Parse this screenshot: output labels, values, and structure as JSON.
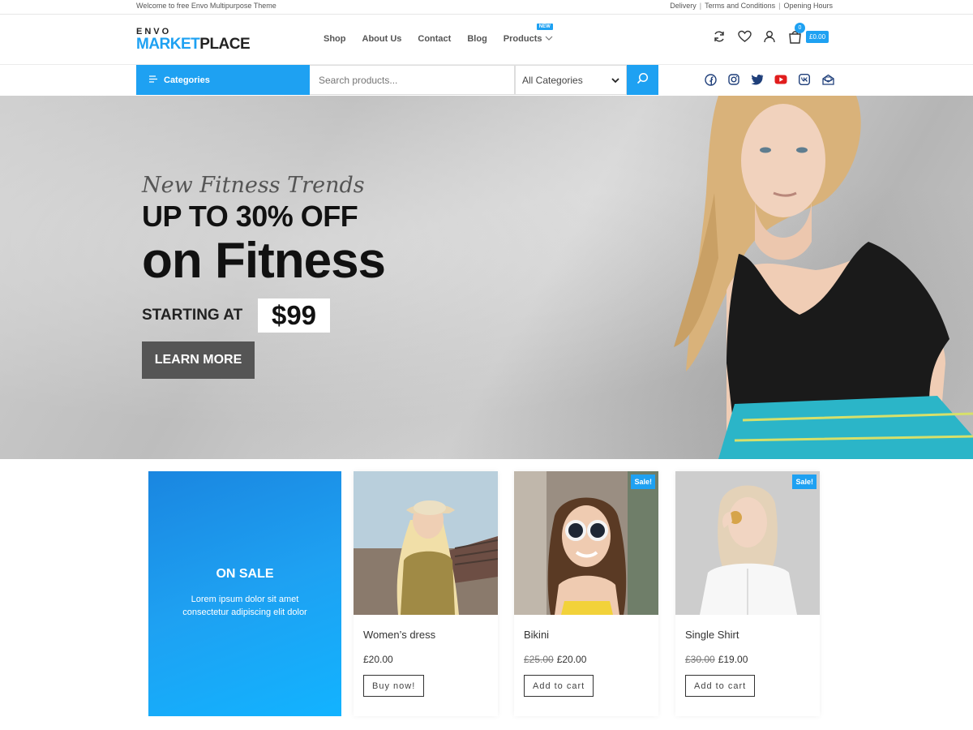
{
  "topbar": {
    "welcome": "Welcome to free Envo Multipurpose Theme",
    "links": [
      "Delivery",
      "Terms and Conditions",
      "Opening Hours"
    ]
  },
  "logo": {
    "top": "ENVO",
    "main_a": "MARKET",
    "main_b": "PLACE"
  },
  "nav": {
    "shop": "Shop",
    "about": "About Us",
    "contact": "Contact",
    "blog": "Blog",
    "products": "Products",
    "new_badge": "NEW"
  },
  "cart": {
    "count": "0",
    "total": "£0.00"
  },
  "search": {
    "categories_button": "Categories",
    "placeholder": "Search products...",
    "category_select": "All Categories"
  },
  "hero": {
    "subtitle": "New Fitness Trends",
    "headline": "UP TO 30% OFF",
    "headline2": "on Fitness",
    "starting_label": "STARTING AT",
    "price": "$99",
    "button": "LEARN MORE"
  },
  "promo": {
    "title": "ON SALE",
    "description": "Lorem ipsum dolor sit amet consectetur adipiscing elit dolor"
  },
  "products": [
    {
      "name": "Women’s dress",
      "old_price": "",
      "price": "£20.00",
      "button": "Buy now!",
      "badge": ""
    },
    {
      "name": "Bikini",
      "old_price": "£25.00",
      "price": "£20.00",
      "button": "Add to cart",
      "badge": "Sale!"
    },
    {
      "name": "Single Shirt",
      "old_price": "£30.00",
      "price": "£19.00",
      "button": "Add to cart",
      "badge": "Sale!"
    }
  ],
  "colors": {
    "accent": "#1ea1f2",
    "dark_button": "#555555",
    "text": "#333333"
  },
  "icons": [
    "refresh-icon",
    "heart-icon",
    "user-icon",
    "cart-icon",
    "list-icon",
    "search-icon",
    "chevron-down-icon",
    "facebook-icon",
    "instagram-icon",
    "twitter-icon",
    "youtube-icon",
    "vk-icon",
    "envelope-icon"
  ]
}
